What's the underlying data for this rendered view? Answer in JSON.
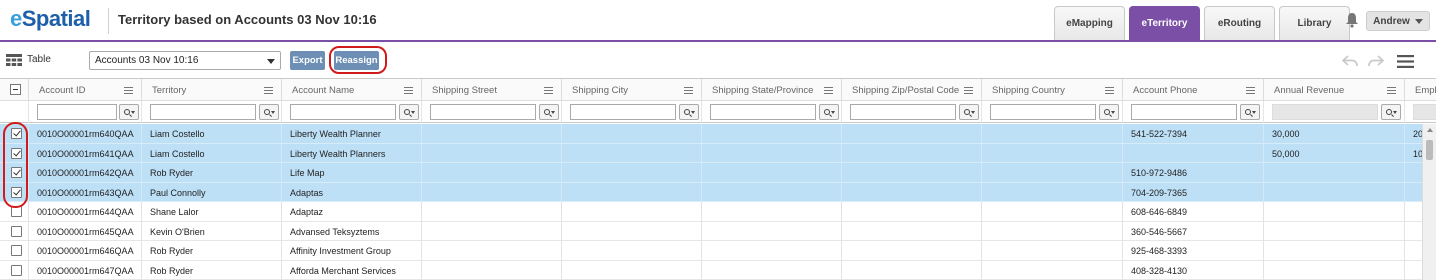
{
  "app": {
    "logo": "eSpatial",
    "title": "Territory based on Accounts 03 Nov 10:16"
  },
  "nav": {
    "tabs": [
      {
        "label": "eMapping",
        "active": false
      },
      {
        "label": "eTerritory",
        "active": true
      },
      {
        "label": "eRouting",
        "active": false
      },
      {
        "label": "Library",
        "active": false
      }
    ],
    "user": "Andrew"
  },
  "toolbar": {
    "view_label": "Table",
    "dataset_select": "Accounts 03 Nov 10:16",
    "export_label": "Export",
    "reassign_label": "Reassign"
  },
  "columns": [
    "Account ID",
    "Territory",
    "Account Name",
    "Shipping Street",
    "Shipping City",
    "Shipping State/Province",
    "Shipping Zip/Postal Code",
    "Shipping Country",
    "Account Phone",
    "Annual Revenue",
    "Emplo"
  ],
  "rows": [
    {
      "selected": true,
      "id": "0010O00001rm640QAA",
      "territory": "Liam Costello",
      "name": "Liberty Wealth Planner",
      "phone": "541-522-7394",
      "revenue": "30,000",
      "emp": "20"
    },
    {
      "selected": true,
      "id": "0010O00001rm641QAA",
      "territory": "Liam Costello",
      "name": "Liberty Wealth Planners",
      "phone": "",
      "revenue": "50,000",
      "emp": "10"
    },
    {
      "selected": true,
      "id": "0010O00001rm642QAA",
      "territory": "Rob Ryder",
      "name": "Life Map",
      "phone": "510-972-9486",
      "revenue": "",
      "emp": ""
    },
    {
      "selected": true,
      "id": "0010O00001rm643QAA",
      "territory": "Paul Connolly",
      "name": "Adaptas",
      "phone": "704-209-7365",
      "revenue": "",
      "emp": ""
    },
    {
      "selected": false,
      "id": "0010O00001rm644QAA",
      "territory": "Shane Lalor",
      "name": "Adaptaz",
      "phone": "608-646-6849",
      "revenue": "",
      "emp": ""
    },
    {
      "selected": false,
      "id": "0010O00001rm645QAA",
      "territory": "Kevin O'Brien",
      "name": "Advansed Teksyztems",
      "phone": "360-546-5667",
      "revenue": "",
      "emp": ""
    },
    {
      "selected": false,
      "id": "0010O00001rm646QAA",
      "territory": "Rob Ryder",
      "name": "Affinity Investment Group",
      "phone": "925-468-3393",
      "revenue": "",
      "emp": ""
    },
    {
      "selected": false,
      "id": "0010O00001rm647QAA",
      "territory": "Rob Ryder",
      "name": "Afforda Merchant Services",
      "phone": "408-328-4130",
      "revenue": "",
      "emp": ""
    }
  ]
}
